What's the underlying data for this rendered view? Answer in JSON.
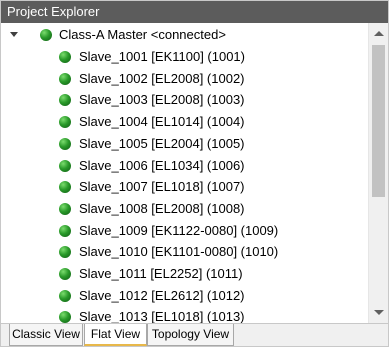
{
  "panel": {
    "title": "Project Explorer"
  },
  "tree": {
    "root": {
      "label": "Class-A Master <connected>",
      "status": "connected"
    },
    "items": [
      {
        "label": "Slave_1001 [EK1100] (1001)"
      },
      {
        "label": "Slave_1002 [EL2008] (1002)"
      },
      {
        "label": "Slave_1003 [EL2008] (1003)"
      },
      {
        "label": "Slave_1004 [EL1014] (1004)"
      },
      {
        "label": "Slave_1005 [EL2004] (1005)"
      },
      {
        "label": "Slave_1006 [EL1034] (1006)"
      },
      {
        "label": "Slave_1007 [EL1018] (1007)"
      },
      {
        "label": "Slave_1008 [EL2008] (1008)"
      },
      {
        "label": "Slave_1009 [EK1122-0080] (1009)"
      },
      {
        "label": "Slave_1010 [EK1101-0080] (1010)"
      },
      {
        "label": "Slave_1011 [EL2252] (1011)"
      },
      {
        "label": "Slave_1012 [EL2612] (1012)"
      },
      {
        "label": "Slave_1013 [EL1018] (1013)"
      }
    ]
  },
  "tabs": [
    {
      "label": "Classic View",
      "active": false
    },
    {
      "label": "Flat View",
      "active": true
    },
    {
      "label": "Topology View",
      "active": false
    }
  ],
  "colors": {
    "titlebar": "#5c5c5c",
    "status_dot": "#2a9a2a",
    "active_tab_accent": "#e8b84a"
  }
}
